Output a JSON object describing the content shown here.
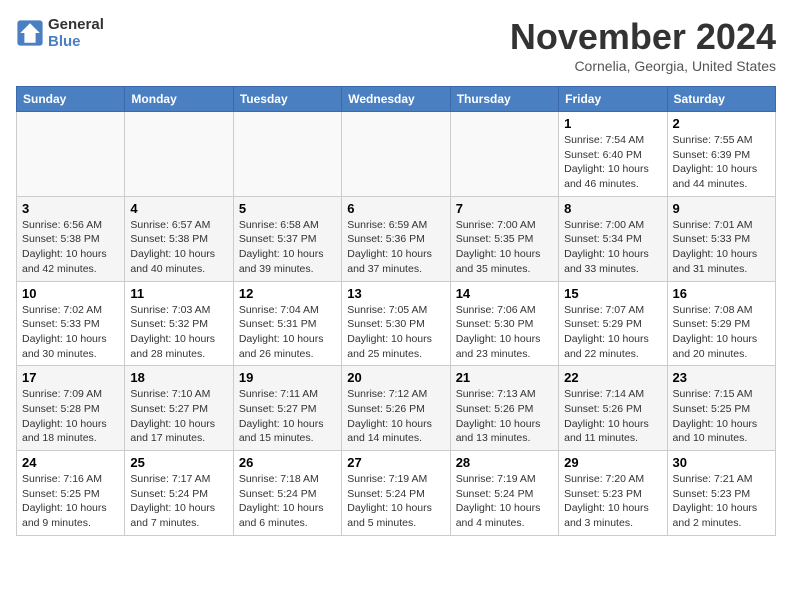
{
  "header": {
    "logo_line1": "General",
    "logo_line2": "Blue",
    "month": "November 2024",
    "location": "Cornelia, Georgia, United States"
  },
  "weekdays": [
    "Sunday",
    "Monday",
    "Tuesday",
    "Wednesday",
    "Thursday",
    "Friday",
    "Saturday"
  ],
  "weeks": [
    [
      {
        "day": "",
        "info": ""
      },
      {
        "day": "",
        "info": ""
      },
      {
        "day": "",
        "info": ""
      },
      {
        "day": "",
        "info": ""
      },
      {
        "day": "",
        "info": ""
      },
      {
        "day": "1",
        "info": "Sunrise: 7:54 AM\nSunset: 6:40 PM\nDaylight: 10 hours and 46 minutes."
      },
      {
        "day": "2",
        "info": "Sunrise: 7:55 AM\nSunset: 6:39 PM\nDaylight: 10 hours and 44 minutes."
      }
    ],
    [
      {
        "day": "3",
        "info": "Sunrise: 6:56 AM\nSunset: 5:38 PM\nDaylight: 10 hours and 42 minutes."
      },
      {
        "day": "4",
        "info": "Sunrise: 6:57 AM\nSunset: 5:38 PM\nDaylight: 10 hours and 40 minutes."
      },
      {
        "day": "5",
        "info": "Sunrise: 6:58 AM\nSunset: 5:37 PM\nDaylight: 10 hours and 39 minutes."
      },
      {
        "day": "6",
        "info": "Sunrise: 6:59 AM\nSunset: 5:36 PM\nDaylight: 10 hours and 37 minutes."
      },
      {
        "day": "7",
        "info": "Sunrise: 7:00 AM\nSunset: 5:35 PM\nDaylight: 10 hours and 35 minutes."
      },
      {
        "day": "8",
        "info": "Sunrise: 7:00 AM\nSunset: 5:34 PM\nDaylight: 10 hours and 33 minutes."
      },
      {
        "day": "9",
        "info": "Sunrise: 7:01 AM\nSunset: 5:33 PM\nDaylight: 10 hours and 31 minutes."
      }
    ],
    [
      {
        "day": "10",
        "info": "Sunrise: 7:02 AM\nSunset: 5:33 PM\nDaylight: 10 hours and 30 minutes."
      },
      {
        "day": "11",
        "info": "Sunrise: 7:03 AM\nSunset: 5:32 PM\nDaylight: 10 hours and 28 minutes."
      },
      {
        "day": "12",
        "info": "Sunrise: 7:04 AM\nSunset: 5:31 PM\nDaylight: 10 hours and 26 minutes."
      },
      {
        "day": "13",
        "info": "Sunrise: 7:05 AM\nSunset: 5:30 PM\nDaylight: 10 hours and 25 minutes."
      },
      {
        "day": "14",
        "info": "Sunrise: 7:06 AM\nSunset: 5:30 PM\nDaylight: 10 hours and 23 minutes."
      },
      {
        "day": "15",
        "info": "Sunrise: 7:07 AM\nSunset: 5:29 PM\nDaylight: 10 hours and 22 minutes."
      },
      {
        "day": "16",
        "info": "Sunrise: 7:08 AM\nSunset: 5:29 PM\nDaylight: 10 hours and 20 minutes."
      }
    ],
    [
      {
        "day": "17",
        "info": "Sunrise: 7:09 AM\nSunset: 5:28 PM\nDaylight: 10 hours and 18 minutes."
      },
      {
        "day": "18",
        "info": "Sunrise: 7:10 AM\nSunset: 5:27 PM\nDaylight: 10 hours and 17 minutes."
      },
      {
        "day": "19",
        "info": "Sunrise: 7:11 AM\nSunset: 5:27 PM\nDaylight: 10 hours and 15 minutes."
      },
      {
        "day": "20",
        "info": "Sunrise: 7:12 AM\nSunset: 5:26 PM\nDaylight: 10 hours and 14 minutes."
      },
      {
        "day": "21",
        "info": "Sunrise: 7:13 AM\nSunset: 5:26 PM\nDaylight: 10 hours and 13 minutes."
      },
      {
        "day": "22",
        "info": "Sunrise: 7:14 AM\nSunset: 5:26 PM\nDaylight: 10 hours and 11 minutes."
      },
      {
        "day": "23",
        "info": "Sunrise: 7:15 AM\nSunset: 5:25 PM\nDaylight: 10 hours and 10 minutes."
      }
    ],
    [
      {
        "day": "24",
        "info": "Sunrise: 7:16 AM\nSunset: 5:25 PM\nDaylight: 10 hours and 9 minutes."
      },
      {
        "day": "25",
        "info": "Sunrise: 7:17 AM\nSunset: 5:24 PM\nDaylight: 10 hours and 7 minutes."
      },
      {
        "day": "26",
        "info": "Sunrise: 7:18 AM\nSunset: 5:24 PM\nDaylight: 10 hours and 6 minutes."
      },
      {
        "day": "27",
        "info": "Sunrise: 7:19 AM\nSunset: 5:24 PM\nDaylight: 10 hours and 5 minutes."
      },
      {
        "day": "28",
        "info": "Sunrise: 7:19 AM\nSunset: 5:24 PM\nDaylight: 10 hours and 4 minutes."
      },
      {
        "day": "29",
        "info": "Sunrise: 7:20 AM\nSunset: 5:23 PM\nDaylight: 10 hours and 3 minutes."
      },
      {
        "day": "30",
        "info": "Sunrise: 7:21 AM\nSunset: 5:23 PM\nDaylight: 10 hours and 2 minutes."
      }
    ]
  ]
}
